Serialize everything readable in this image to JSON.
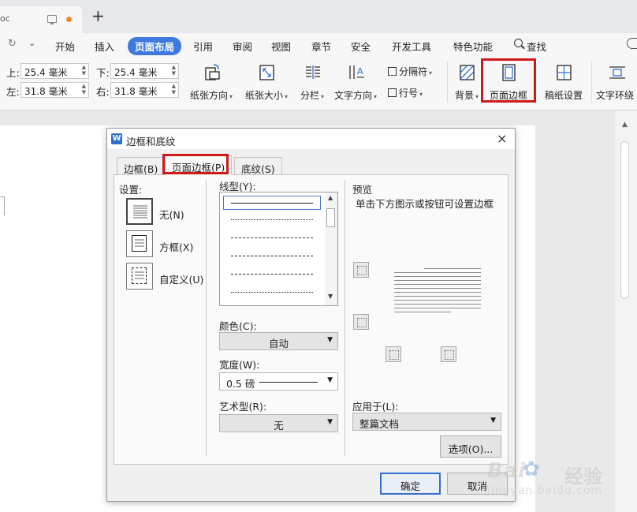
{
  "colors": {
    "accent": "#3e7ae0",
    "highlight_red": "#d01818",
    "unsaved_dot": "#f08a2c",
    "wps_icon": "#2f6fd0"
  },
  "tabstrip": {
    "doc_tab_title": "oc",
    "new_tab_icon": "+"
  },
  "menubar": {
    "items": [
      "开始",
      "插入",
      "页面布局",
      "引用",
      "审阅",
      "视图",
      "章节",
      "安全",
      "开发工具",
      "特色功能"
    ],
    "active_index": 2,
    "search_label": "查找",
    "redo_icon": "↻",
    "qa_dropdown_icon": "⌄"
  },
  "ribbon": {
    "margins": {
      "top_label": "上:",
      "top_value": "25.4 毫米",
      "bottom_label": "下:",
      "bottom_value": "25.4 毫米",
      "left_label": "左:",
      "left_value": "31.8 毫米",
      "right_label": "右:",
      "right_value": "31.8 毫米"
    },
    "orientation_label": "纸张方向",
    "size_label": "纸张大小",
    "columns_label": "分栏",
    "text_direction_label": "文字方向",
    "breaks_label": "分隔符",
    "line_numbers_label": "行号",
    "background_label": "背景",
    "page_border_label": "页面边框",
    "manuscript_label": "稿纸设置",
    "text_wrap_label": "文字环绕"
  },
  "dialog": {
    "title": "边框和底纹",
    "app_icon_letter": "W",
    "close_icon": "×",
    "tabs": [
      "边框(B)",
      "页面边框(P)",
      "底纹(S)"
    ],
    "selected_tab": 1,
    "settings_label": "设置:",
    "settings": [
      "无(N)",
      "方框(X)",
      "自定义(U)"
    ],
    "linestyle_label": "线型(Y):",
    "color_label": "颜色(C):",
    "color_value": "自动",
    "width_label": "宽度(W):",
    "width_value": "0.5   磅",
    "art_label": "艺术型(R):",
    "art_value": "无",
    "preview_label": "预览",
    "preview_hint": "单击下方图示或按钮可设置边框",
    "apply_label": "应用于(L):",
    "apply_value": "整篇文档",
    "options_button": "选项(O)...",
    "ok_button": "确定",
    "cancel_button": "取消"
  },
  "watermark": {
    "brand": "Bai",
    "brand_suffix": "经验",
    "url": "jingyan.baidu.com"
  }
}
